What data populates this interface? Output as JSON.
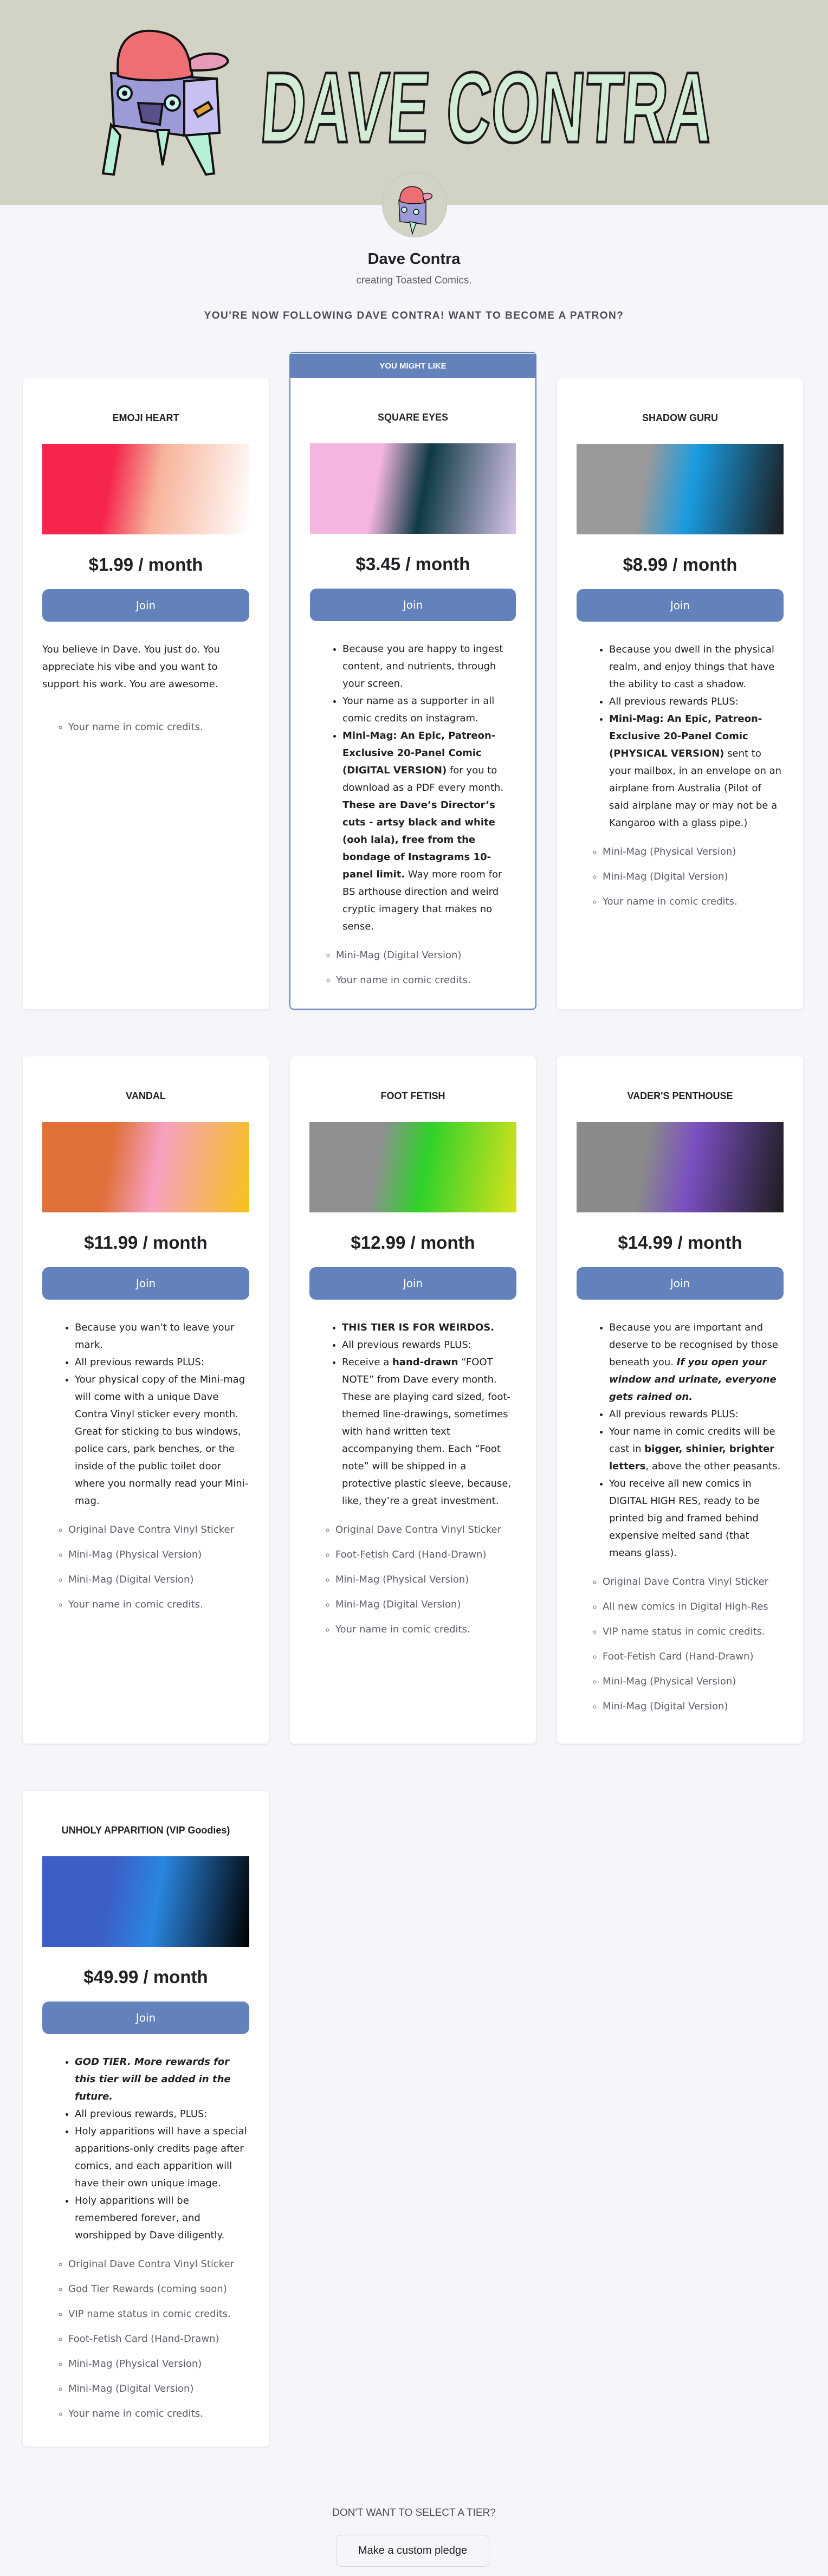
{
  "banner": {
    "logo_text": "DAVE CONTRA"
  },
  "creator": {
    "name": "Dave Contra",
    "tagline": "creating Toasted Comics."
  },
  "follow_heading": "YOU'RE NOW FOLLOWING DAVE CONTRA! WANT TO BECOME A PATRON?",
  "colors": {
    "accent": "#6381bb",
    "background": "#f5f6fa",
    "banner": "#d3d3c5"
  },
  "tiers": [
    {
      "title": "EMOJI HEART",
      "price": "$1.99 / month",
      "join_label": "Join",
      "image_colors": [
        "#f5254d",
        "#f7b39a",
        "#ffffff"
      ],
      "description": {
        "type": "paragraph",
        "items": [
          [
            {
              "t": "You believe in Dave. You just do. You appreciate his vibe and you want to support his work. You are awesome."
            }
          ]
        ]
      },
      "benefits": [
        "Your name in comic credits."
      ]
    },
    {
      "title": "SQUARE EYES",
      "price": "$3.45 / month",
      "join_label": "Join",
      "badge": "YOU MIGHT LIKE",
      "image_colors": [
        "#f4b6e0",
        "#0e3a44",
        "#d9c6ea"
      ],
      "description": {
        "type": "bullets",
        "items": [
          [
            {
              "t": "Because you are happy to ingest content, and nutrients, through your screen."
            }
          ],
          [
            {
              "t": "Your name as a supporter in all comic credits on instagram."
            }
          ],
          [
            {
              "t": "Mini-Mag: An Epic, Patreon-Exclusive 20-Panel Comic (DIGITAL VERSION)",
              "b": true
            },
            {
              "t": " for you to download as a PDF every month. "
            },
            {
              "t": "These are Dave’s Director’s cuts - artsy black and white (ooh lala), free from the bondage of Instagrams 10-panel limit.",
              "b": true
            },
            {
              "t": " Way more room for BS arthouse direction and weird cryptic imagery that makes no sense."
            }
          ]
        ]
      },
      "benefits": [
        "Mini-Mag (Digital Version)",
        "Your name in comic credits."
      ]
    },
    {
      "title": "SHADOW GURU",
      "price": "$8.99 / month",
      "join_label": "Join",
      "image_colors": [
        "#9a9a9a",
        "#1a9be0",
        "#1b1b1b"
      ],
      "description": {
        "type": "bullets",
        "items": [
          [
            {
              "t": "Because you dwell in the physical realm, and enjoy things that have the ability to cast a shadow."
            }
          ],
          [
            {
              "t": "All previous rewards PLUS:"
            }
          ],
          [
            {
              "t": "Mini-Mag: An Epic, Patreon-Exclusive 20-Panel Comic (PHYSICAL VERSION)",
              "b": true
            },
            {
              "t": " sent to your mailbox, in an envelope on an airplane from Australia (Pilot of said airplane may or may not be a Kangaroo with a glass pipe.)"
            }
          ]
        ]
      },
      "benefits": [
        "Mini-Mag (Physical Version)",
        "Mini-Mag (Digital Version)",
        "Your name in comic credits."
      ]
    },
    {
      "title": "VANDAL",
      "price": "$11.99 / month",
      "join_label": "Join",
      "image_colors": [
        "#e0703a",
        "#f7a0c0",
        "#f6c21a"
      ],
      "description": {
        "type": "bullets",
        "items": [
          [
            {
              "t": "Because you wan't to leave your mark."
            }
          ],
          [
            {
              "t": "All previous rewards PLUS:"
            }
          ],
          [
            {
              "t": "Your physical copy of the Mini-mag will come with a unique Dave Contra Vinyl sticker every month. Great for sticking to bus windows, police cars, park benches, or the inside of the public toilet door where you normally read your Mini-mag."
            }
          ]
        ]
      },
      "benefits": [
        "Original Dave Contra Vinyl Sticker",
        "Mini-Mag (Physical Version)",
        "Mini-Mag (Digital Version)",
        "Your name in comic credits."
      ]
    },
    {
      "title": "FOOT FETISH",
      "price": "$12.99 / month",
      "join_label": "Join",
      "image_colors": [
        "#8f8f92",
        "#2fd12a",
        "#d9e21c"
      ],
      "description": {
        "type": "bullets",
        "items": [
          [
            {
              "t": "THIS TIER IS FOR WEIRDOS.",
              "b": true
            }
          ],
          [
            {
              "t": "All previous rewards PLUS:"
            }
          ],
          [
            {
              "t": "Receive a "
            },
            {
              "t": "hand-drawn",
              "b": true
            },
            {
              "t": " “FOOT NOTE” from Dave every month. These are playing card sized, foot-themed line-drawings, sometimes with hand written text accompanying them. Each “Foot note” will be shipped in a protective plastic sleeve, because, like, they’re a great investment."
            }
          ]
        ]
      },
      "benefits": [
        "Original Dave Contra Vinyl Sticker",
        "Foot-Fetish Card (Hand-Drawn)",
        "Mini-Mag (Physical Version)",
        "Mini-Mag (Digital Version)",
        "Your name in comic credits."
      ]
    },
    {
      "title": "VADER'S PENTHOUSE",
      "price": "$14.99 / month",
      "join_label": "Join",
      "image_colors": [
        "#8a8a8a",
        "#7a4fc0",
        "#1c1c1c"
      ],
      "description": {
        "type": "bullets",
        "items": [
          [
            {
              "t": "Because you are important and deserve to be recognised by those beneath you. "
            },
            {
              "t": "If you open your window and urinate, everyone gets rained on.",
              "b": true,
              "i": true
            }
          ],
          [
            {
              "t": "All previous rewards PLUS:"
            }
          ],
          [
            {
              "t": "Your name in comic credits will be cast in "
            },
            {
              "t": "bigger, shinier, brighter letters",
              "b": true
            },
            {
              "t": ", above the other peasants."
            }
          ],
          [
            {
              "t": "You receive all new comics in DIGITAL HIGH RES, ready to be printed big and framed behind expensive melted sand (that means glass)."
            }
          ]
        ]
      },
      "benefits": [
        "Original Dave Contra Vinyl Sticker",
        "All new comics in Digital High-Res",
        "VIP name status in comic credits.",
        "Foot-Fetish Card (Hand-Drawn)",
        "Mini-Mag (Physical Version)",
        "Mini-Mag (Digital Version)"
      ]
    },
    {
      "title": "UNHOLY APPARITION (VIP Goodies)",
      "price": "$49.99 / month",
      "join_label": "Join",
      "image_colors": [
        "#3c5fc7",
        "#2a86e0",
        "#000000"
      ],
      "description": {
        "type": "bullets",
        "items": [
          [
            {
              "t": "GOD TIER. More rewards for this tier will be added in the future.",
              "b": true,
              "i": true
            }
          ],
          [
            {
              "t": "All previous rewards, PLUS:"
            }
          ],
          [
            {
              "t": "Holy apparitions will have a special apparitions-only credits page after comics, and each apparition will have their own unique image."
            }
          ],
          [
            {
              "t": "Holy apparitions will be remembered forever, and worshipped by Dave diligently."
            }
          ]
        ]
      },
      "benefits": [
        "Original Dave Contra Vinyl Sticker",
        "God Tier Rewards (coming soon)",
        "VIP name status in comic credits.",
        "Foot-Fetish Card (Hand-Drawn)",
        "Mini-Mag (Physical Version)",
        "Mini-Mag (Digital Version)",
        "Your name in comic credits."
      ]
    }
  ],
  "custom": {
    "heading": "DON'T WANT TO SELECT A TIER?",
    "button_label": "Make a custom pledge"
  }
}
